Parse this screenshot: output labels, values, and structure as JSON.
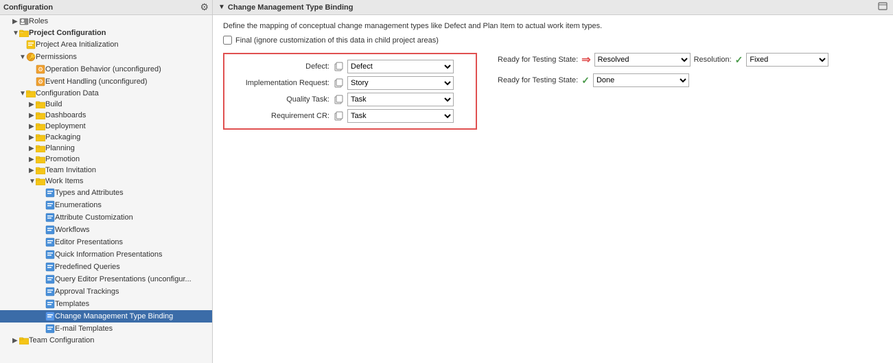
{
  "sidebar": {
    "title": "Configuration",
    "items": [
      {
        "id": "roles",
        "label": "Roles",
        "indent": 1,
        "type": "roles",
        "expanded": false
      },
      {
        "id": "project-config",
        "label": "Project Configuration",
        "indent": 1,
        "type": "folder",
        "expanded": true
      },
      {
        "id": "project-area-init",
        "label": "Project Area Initialization",
        "indent": 2,
        "type": "item",
        "expanded": false
      },
      {
        "id": "permissions",
        "label": "Permissions",
        "indent": 2,
        "type": "item-special",
        "expanded": false
      },
      {
        "id": "operation-behavior",
        "label": "Operation Behavior (unconfigured)",
        "indent": 3,
        "type": "item-orange",
        "expanded": false
      },
      {
        "id": "event-handling",
        "label": "Event Handling (unconfigured)",
        "indent": 3,
        "type": "item-orange",
        "expanded": false
      },
      {
        "id": "config-data",
        "label": "Configuration Data",
        "indent": 2,
        "type": "folder",
        "expanded": true
      },
      {
        "id": "build",
        "label": "Build",
        "indent": 3,
        "type": "folder",
        "expanded": false
      },
      {
        "id": "dashboards",
        "label": "Dashboards",
        "indent": 3,
        "type": "folder",
        "expanded": false
      },
      {
        "id": "deployment",
        "label": "Deployment",
        "indent": 3,
        "type": "folder",
        "expanded": false
      },
      {
        "id": "packaging",
        "label": "Packaging",
        "indent": 3,
        "type": "folder",
        "expanded": false
      },
      {
        "id": "planning",
        "label": "Planning",
        "indent": 3,
        "type": "folder",
        "expanded": false
      },
      {
        "id": "promotion",
        "label": "Promotion",
        "indent": 3,
        "type": "folder",
        "expanded": false
      },
      {
        "id": "team-invitation",
        "label": "Team Invitation",
        "indent": 3,
        "type": "folder",
        "expanded": false
      },
      {
        "id": "work-items",
        "label": "Work Items",
        "indent": 3,
        "type": "folder",
        "expanded": true
      },
      {
        "id": "types-attributes",
        "label": "Types and Attributes",
        "indent": 4,
        "type": "item-blue",
        "expanded": false
      },
      {
        "id": "enumerations",
        "label": "Enumerations",
        "indent": 4,
        "type": "item-blue",
        "expanded": false
      },
      {
        "id": "attribute-customization",
        "label": "Attribute Customization",
        "indent": 4,
        "type": "item-blue",
        "expanded": false
      },
      {
        "id": "workflows",
        "label": "Workflows",
        "indent": 4,
        "type": "item-blue",
        "expanded": false
      },
      {
        "id": "editor-presentations",
        "label": "Editor Presentations",
        "indent": 4,
        "type": "item-blue",
        "expanded": false
      },
      {
        "id": "quick-info-presentations",
        "label": "Quick Information Presentations",
        "indent": 4,
        "type": "item-blue",
        "expanded": false
      },
      {
        "id": "predefined-queries",
        "label": "Predefined Queries",
        "indent": 4,
        "type": "item-blue",
        "expanded": false
      },
      {
        "id": "query-editor",
        "label": "Query Editor Presentations (unconfigur...",
        "indent": 4,
        "type": "item-blue",
        "expanded": false
      },
      {
        "id": "approval-trackings",
        "label": "Approval Trackings",
        "indent": 4,
        "type": "item-blue",
        "expanded": false
      },
      {
        "id": "templates",
        "label": "Templates",
        "indent": 4,
        "type": "item-blue",
        "expanded": false
      },
      {
        "id": "change-mgmt-binding",
        "label": "Change Management Type Binding",
        "indent": 4,
        "type": "item-blue",
        "expanded": false,
        "selected": true
      },
      {
        "id": "email-templates",
        "label": "E-mail Templates",
        "indent": 4,
        "type": "item-blue",
        "expanded": false
      },
      {
        "id": "team-config",
        "label": "Team Configuration",
        "indent": 1,
        "type": "folder",
        "expanded": false
      }
    ]
  },
  "main": {
    "header_title": "Change Management Type Binding",
    "description": "Define the mapping of conceptual change management types like Defect and Plan Item to actual work item types.",
    "checkbox_label": "Final (ignore customization of this data in child project areas)",
    "bindings": [
      {
        "label": "Defect:",
        "value": "Defect"
      },
      {
        "label": "Implementation Request:",
        "value": "Story"
      },
      {
        "label": "Quality Task:",
        "value": "Task"
      },
      {
        "label": "Requirement CR:",
        "value": "Task"
      }
    ],
    "states": [
      {
        "label": "Ready for Testing State:",
        "icon": "arrow",
        "state_value": "Resolved",
        "resolution_label": "Resolution:",
        "resolution_icon": "check",
        "resolution_value": "Fixed"
      },
      {
        "label": "Ready for Testing State:",
        "icon": "check",
        "state_value": "Done",
        "resolution_label": "",
        "resolution_icon": "",
        "resolution_value": ""
      }
    ]
  }
}
